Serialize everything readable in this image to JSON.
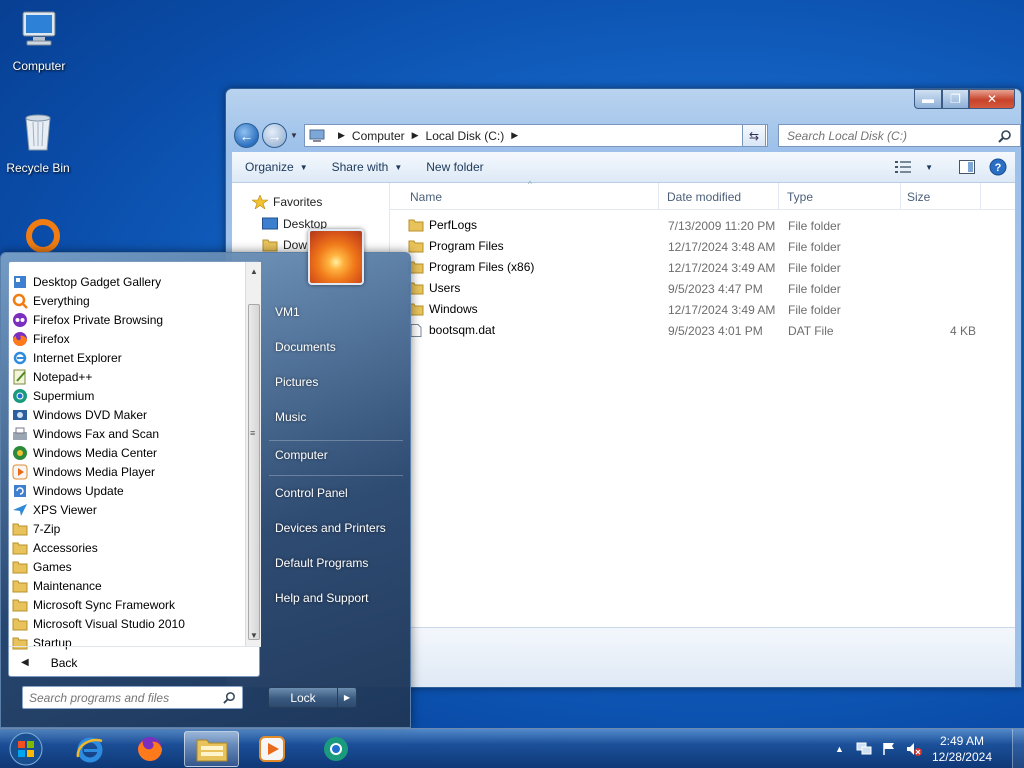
{
  "desktop": {
    "icons": [
      {
        "label": "Computer",
        "icon": "computer-icon"
      },
      {
        "label": "Recycle Bin",
        "icon": "recycle-bin-icon"
      },
      {
        "label": "",
        "icon": "everything-search-icon"
      }
    ]
  },
  "explorer": {
    "controls": {
      "minimize": "▬",
      "maximize": "❐",
      "close": "✕"
    },
    "address": {
      "crumbs": [
        "Computer",
        "Local Disk (C:)"
      ]
    },
    "search": {
      "placeholder": "Search Local Disk (C:)"
    },
    "toolbar": {
      "organize": "Organize",
      "share_with": "Share with",
      "new_folder": "New folder"
    },
    "navpane": {
      "favorites": "Favorites",
      "items": [
        "Desktop",
        "Dow"
      ]
    },
    "columns": {
      "name": "Name",
      "date": "Date modified",
      "type": "Type",
      "size": "Size"
    },
    "files": [
      {
        "name": "PerfLogs",
        "date": "7/13/2009 11:20 PM",
        "type": "File folder",
        "size": "",
        "kind": "folder"
      },
      {
        "name": "Program Files",
        "date": "12/17/2024 3:48 AM",
        "type": "File folder",
        "size": "",
        "kind": "folder"
      },
      {
        "name": "Program Files (x86)",
        "date": "12/17/2024 3:49 AM",
        "type": "File folder",
        "size": "",
        "kind": "folder"
      },
      {
        "name": "Users",
        "date": "9/5/2023 4:47 PM",
        "type": "File folder",
        "size": "",
        "kind": "folder"
      },
      {
        "name": "Windows",
        "date": "12/17/2024 3:49 AM",
        "type": "File folder",
        "size": "",
        "kind": "folder"
      },
      {
        "name": "bootsqm.dat",
        "date": "9/5/2023 4:01 PM",
        "type": "DAT File",
        "size": "4 KB",
        "kind": "file"
      }
    ]
  },
  "startmenu": {
    "programs": [
      {
        "label": "Desktop Gadget Gallery",
        "icon": "gadget-icon"
      },
      {
        "label": "Everything",
        "icon": "everything-icon"
      },
      {
        "label": "Firefox Private Browsing",
        "icon": "firefox-private-icon"
      },
      {
        "label": "Firefox",
        "icon": "firefox-icon"
      },
      {
        "label": "Internet Explorer",
        "icon": "internet-explorer-icon"
      },
      {
        "label": "Notepad++",
        "icon": "notepadpp-icon"
      },
      {
        "label": "Supermium",
        "icon": "supermium-icon"
      },
      {
        "label": "Windows DVD Maker",
        "icon": "dvd-maker-icon"
      },
      {
        "label": "Windows Fax and Scan",
        "icon": "fax-scan-icon"
      },
      {
        "label": "Windows Media Center",
        "icon": "media-center-icon"
      },
      {
        "label": "Windows Media Player",
        "icon": "media-player-icon"
      },
      {
        "label": "Windows Update",
        "icon": "windows-update-icon"
      },
      {
        "label": "XPS Viewer",
        "icon": "xps-viewer-icon"
      },
      {
        "label": "7-Zip",
        "icon": "folder-icon"
      },
      {
        "label": "Accessories",
        "icon": "folder-icon"
      },
      {
        "label": "Games",
        "icon": "folder-icon"
      },
      {
        "label": "Maintenance",
        "icon": "folder-icon"
      },
      {
        "label": "Microsoft Sync Framework",
        "icon": "folder-icon"
      },
      {
        "label": "Microsoft Visual Studio 2010",
        "icon": "folder-icon"
      },
      {
        "label": "Startup",
        "icon": "folder-icon"
      }
    ],
    "back_label": "Back",
    "search_placeholder": "Search programs and files",
    "right_links": [
      {
        "label": "VM1",
        "group": 0
      },
      {
        "label": "Documents",
        "group": 0
      },
      {
        "label": "Pictures",
        "group": 0
      },
      {
        "label": "Music",
        "group": 0
      },
      {
        "label": "Computer",
        "group": 1
      },
      {
        "label": "Control Panel",
        "group": 2
      },
      {
        "label": "Devices and Printers",
        "group": 2
      },
      {
        "label": "Default Programs",
        "group": 2
      },
      {
        "label": "Help and Support",
        "group": 2
      }
    ],
    "lock_label": "Lock",
    "lock_arrow": "▶"
  },
  "taskbar": {
    "pinned": [
      "internet-explorer-icon",
      "firefox-icon",
      "file-explorer-icon",
      "media-player-icon",
      "supermium-icon"
    ],
    "active": "file-explorer-icon",
    "tray": {
      "show_hidden": "▲"
    },
    "clock": {
      "time": "2:49 AM",
      "date": "12/28/2024"
    }
  },
  "colors": {
    "accent": "#1567c9",
    "folder": "#e8c25a",
    "taskbar": "#1e5096"
  }
}
